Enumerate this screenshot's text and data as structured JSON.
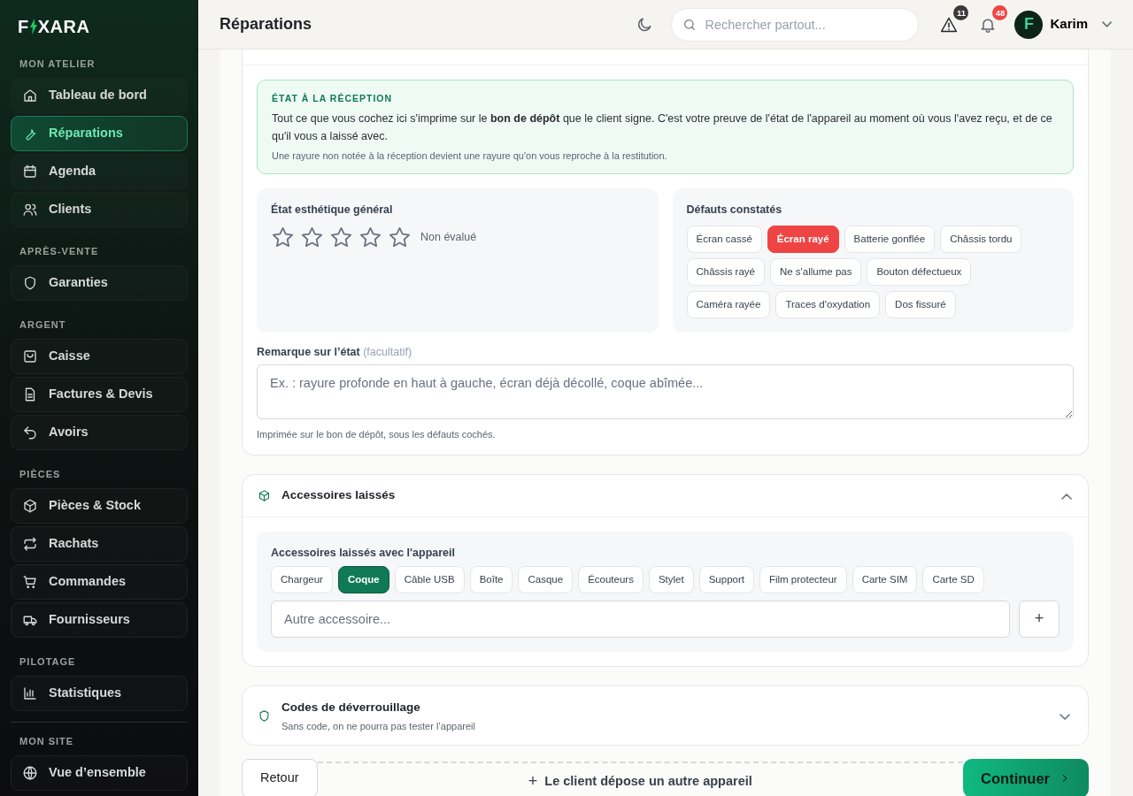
{
  "sidebar": {
    "logo": [
      "F",
      "XARA"
    ],
    "sections": [
      {
        "label": "MON ATELIER",
        "items": [
          {
            "label": "Tableau de bord",
            "selected": false
          },
          {
            "label": "Réparations",
            "selected": true
          },
          {
            "label": "Agenda",
            "selected": false
          },
          {
            "label": "Clients",
            "selected": false
          }
        ]
      },
      {
        "label": "APRÈS-VENTE",
        "items": [
          {
            "label": "Garanties",
            "selected": false
          }
        ]
      },
      {
        "label": "ARGENT",
        "items": [
          {
            "label": "Caisse",
            "selected": false
          },
          {
            "label": "Factures & Devis",
            "selected": false
          },
          {
            "label": "Avoirs",
            "selected": false
          }
        ]
      },
      {
        "label": "PIÈCES",
        "items": [
          {
            "label": "Pièces & Stock",
            "selected": false
          },
          {
            "label": "Rachats",
            "selected": false
          },
          {
            "label": "Commandes",
            "selected": false
          },
          {
            "label": "Fournisseurs",
            "selected": false
          }
        ]
      },
      {
        "label": "PILOTAGE",
        "items": [
          {
            "label": "Statistiques",
            "selected": false
          }
        ]
      },
      {
        "label": "MON SITE",
        "divider": true,
        "items": [
          {
            "label": "Vue d’ensemble",
            "selected": false
          }
        ]
      }
    ]
  },
  "header": {
    "title": "Réparations",
    "search": {
      "placeholder": "Rechercher partout..."
    },
    "alerts_count": "11",
    "notifications_count": "48",
    "user": {
      "initial": "F",
      "name": "Karim"
    }
  },
  "condition_card": {
    "notice": {
      "title": "ÉTAT À LA RÉCEPTION",
      "text": "Tout ce que vous cochez ici s'imprime sur le **bon de dépôt** que le client signe. C'est votre preuve de l'état de l'appareil au moment où vous l'avez reçu, et de ce qu'il vous a laissé avec.",
      "note": "Une rayure non notée à la réception devient une rayure qu'on vous reproche à la restitution."
    },
    "cosmetic": {
      "label": "État esthétique général",
      "stars": 0,
      "status": "Non évalué"
    },
    "defects": {
      "label": "Défauts constatés",
      "items": [
        {
          "label": "Écran cassé",
          "selected": false
        },
        {
          "label": "Écran rayé",
          "selected": true
        },
        {
          "label": "Batterie gonflée",
          "selected": false
        },
        {
          "label": "Châssis tordu",
          "selected": false
        },
        {
          "label": "Châssis rayé",
          "selected": false
        },
        {
          "label": "Ne s'allume pas",
          "selected": false
        },
        {
          "label": "Bouton défectueux",
          "selected": false
        },
        {
          "label": "Caméra rayée",
          "selected": false
        },
        {
          "label": "Traces d'oxydation",
          "selected": false
        },
        {
          "label": "Dos fissuré",
          "selected": false
        }
      ]
    },
    "remark": {
      "label": "Remarque sur l’état",
      "optional": "(facultatif)",
      "placeholder": "Ex. : rayure profonde en haut à gauche, écran déjà décollé, coque abîmée...",
      "hint": "Imprimée sur le bon de dépôt, sous les défauts cochés."
    }
  },
  "accessories_card": {
    "title": "Accessoires laissés",
    "expanded": true,
    "label": "Accessoires laissés avec l'appareil",
    "items": [
      {
        "label": "Chargeur",
        "selected": false
      },
      {
        "label": "Coque",
        "selected": true
      },
      {
        "label": "Câble USB",
        "selected": false
      },
      {
        "label": "Boîte",
        "selected": false
      },
      {
        "label": "Casque",
        "selected": false
      },
      {
        "label": "Écouteurs",
        "selected": false
      },
      {
        "label": "Stylet",
        "selected": false
      },
      {
        "label": "Support",
        "selected": false
      },
      {
        "label": "Film protecteur",
        "selected": false
      },
      {
        "label": "Carte SIM",
        "selected": false
      },
      {
        "label": "Carte SD",
        "selected": false
      }
    ],
    "other": {
      "placeholder": "Autre accessoire..."
    },
    "add_button": "+"
  },
  "codes_card": {
    "title": "Codes de déverrouillage",
    "subtitle": "Sans code, on ne pourra pas tester l’appareil",
    "expanded": false
  },
  "footer": {
    "back": "Retour",
    "add_device": "+",
    "add_device_label": "Le client dépose un autre appareil",
    "continue": "Continuer"
  }
}
